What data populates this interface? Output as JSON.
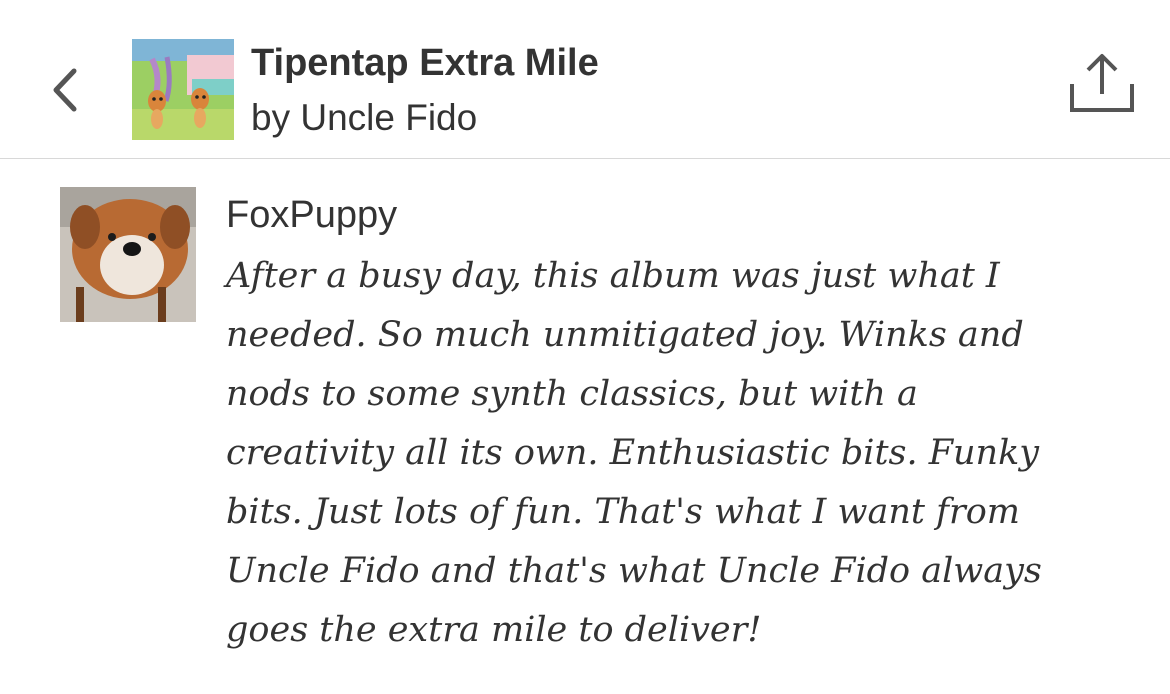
{
  "header": {
    "back_icon": "chevron-left-icon",
    "album_title": "Tipentap Extra Mile",
    "album_artist": "by Uncle Fido",
    "share_icon": "share-icon"
  },
  "review": {
    "reviewer": "FoxPuppy",
    "lines": [
      "After a busy day, this album was just what I",
      "needed.  So much unmitigated joy. Winks and",
      "nods to some synth classics, but with a",
      "creativity all its own. Enthusiastic bits.  Funky",
      "bits.  Just lots of fun.  That's what I want from",
      "Uncle Fido and that's what Uncle Fido always",
      "goes the extra mile to deliver!"
    ]
  },
  "colors": {
    "text": "#333333",
    "divider": "#d8d8d8",
    "icon": "#555555"
  }
}
